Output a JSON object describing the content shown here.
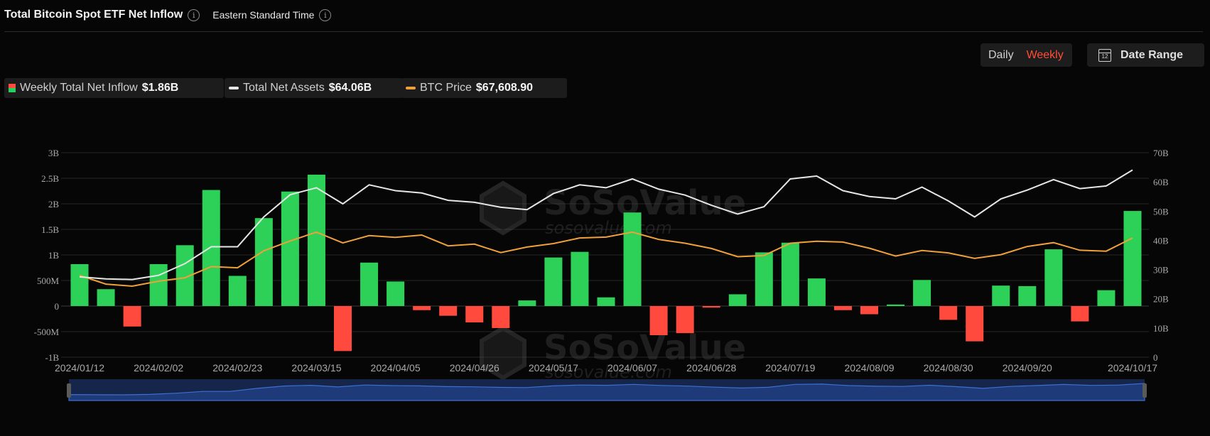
{
  "header": {
    "title": "Total Bitcoin Spot ETF Net Inflow",
    "timezone": "Eastern Standard Time"
  },
  "controls": {
    "period_options": [
      "Daily",
      "Weekly"
    ],
    "period_selected": "Weekly",
    "date_range_label": "Date Range",
    "calendar_day": "12"
  },
  "legend": [
    {
      "label": "Weekly Total Net Inflow",
      "value": "$1.86B"
    },
    {
      "label": "Total Net Assets",
      "value": "$64.06B"
    },
    {
      "label": "BTC Price",
      "value": "$67,608.90"
    }
  ],
  "watermark": {
    "brand": "SoSoValue",
    "url": "sosovalue.com"
  },
  "colors": {
    "inflow_positive": "#2ed158",
    "inflow_negative": "#ff4a3d",
    "total_net_assets": "#e6e6e6",
    "btc_price": "#f0a03a",
    "accent": "#ff4d36"
  },
  "chart_data": {
    "type": "bar",
    "title": "Total Bitcoin Spot ETF Net Inflow",
    "x_tick_labels": [
      "2024/01/12",
      "2024/02/02",
      "2024/02/23",
      "2024/03/15",
      "2024/04/05",
      "2024/04/26",
      "2024/05/17",
      "2024/06/07",
      "2024/06/28",
      "2024/07/19",
      "2024/08/09",
      "2024/08/30",
      "2024/09/20",
      "2024/10/17"
    ],
    "y_left_ticks": [
      "3B",
      "2.5B",
      "2B",
      "1.5B",
      "1B",
      "500M",
      "0",
      "-500M",
      "-1B"
    ],
    "y_left_lim": [
      -1000000000,
      3000000000
    ],
    "y_right_ticks": [
      "70B",
      "60B",
      "50B",
      "40B",
      "30B",
      "20B",
      "10B",
      "0"
    ],
    "y_right_lim": [
      0,
      70000000000
    ],
    "grid": true,
    "series": [
      {
        "name": "Weekly Total Net Inflow",
        "type": "bar",
        "values": [
          820000000,
          330000000,
          -400000000,
          820000000,
          1190000000,
          2270000000,
          590000000,
          1720000000,
          2240000000,
          2570000000,
          -880000000,
          850000000,
          480000000,
          -80000000,
          -190000000,
          -320000000,
          -430000000,
          110000000,
          950000000,
          1060000000,
          170000000,
          1830000000,
          -570000000,
          -530000000,
          -30000000,
          230000000,
          1050000000,
          1240000000,
          540000000,
          -80000000,
          -160000000,
          30000000,
          510000000,
          -270000000,
          -690000000,
          400000000,
          390000000,
          1110000000,
          -300000000,
          310000000,
          1860000000
        ]
      },
      {
        "name": "Total Net Assets",
        "type": "line",
        "values": [
          27500000000,
          26800000000,
          26600000000,
          28000000000,
          32000000000,
          37800000000,
          37800000000,
          48000000000,
          55600000000,
          58000000000,
          52500000000,
          59000000000,
          57000000000,
          56200000000,
          53700000000,
          53000000000,
          51300000000,
          50500000000,
          56000000000,
          59000000000,
          58000000000,
          61000000000,
          57500000000,
          55500000000,
          52000000000,
          49000000000,
          51500000000,
          61000000000,
          62000000000,
          57000000000,
          55000000000,
          54200000000,
          58200000000,
          53500000000,
          48000000000,
          54200000000,
          57200000000,
          60800000000,
          57700000000,
          58600000000,
          64060000000
        ]
      },
      {
        "name": "BTC Price",
        "type": "line",
        "values": [
          28000000000,
          25000000000,
          24300000000,
          26000000000,
          27200000000,
          31000000000,
          30600000000,
          36400000000,
          39800000000,
          42800000000,
          39100000000,
          41600000000,
          41000000000,
          41800000000,
          38100000000,
          38700000000,
          35800000000,
          37700000000,
          38900000000,
          40800000000,
          41100000000,
          42800000000,
          40300000000,
          39000000000,
          37200000000,
          34400000000,
          34800000000,
          39000000000,
          39700000000,
          39400000000,
          37300000000,
          34600000000,
          36500000000,
          35700000000,
          33800000000,
          35100000000,
          37900000000,
          39200000000,
          36600000000,
          36300000000,
          40800000000
        ]
      }
    ]
  }
}
